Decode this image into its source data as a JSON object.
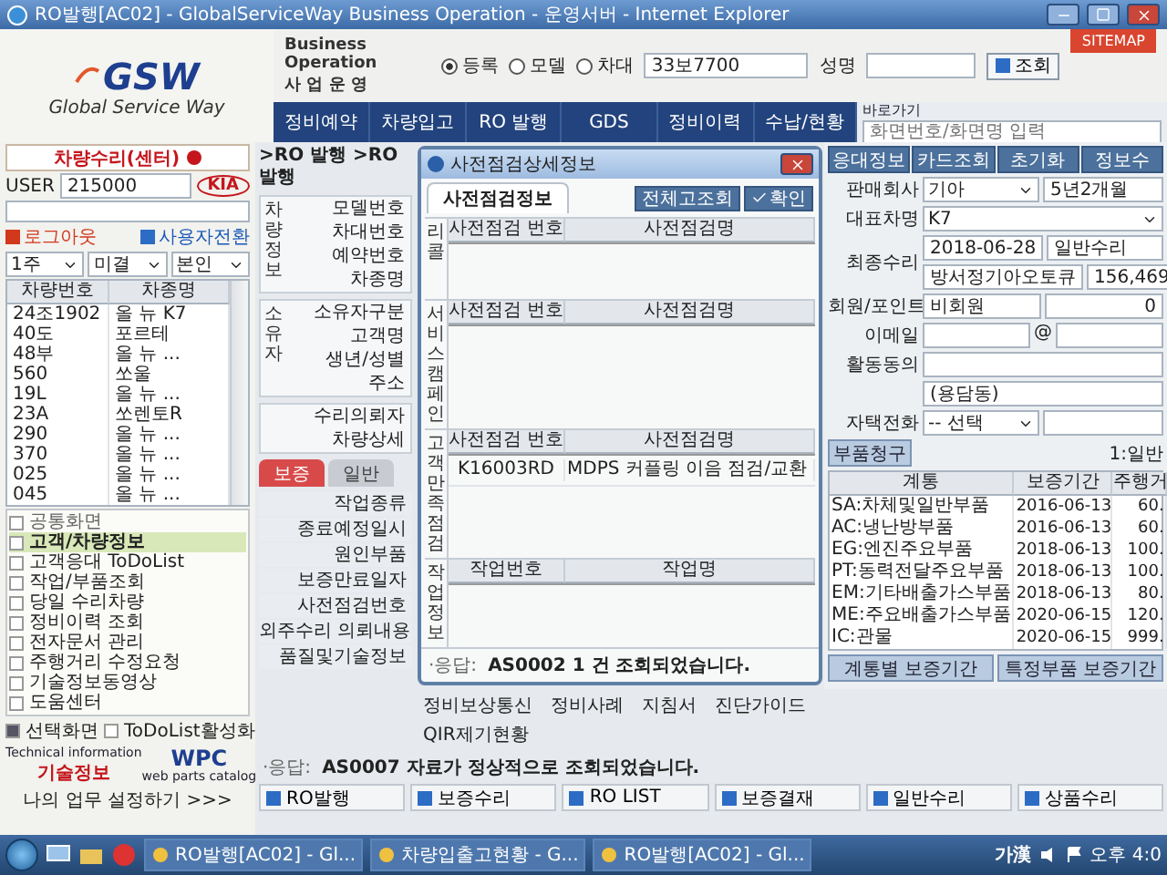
{
  "window": {
    "title": "RO발행[AC02] - GlobalServiceWay Business Operation - 운영서버 - Internet Explorer"
  },
  "header": {
    "logo": "GSW",
    "tagline": "Global Service Way",
    "app_title": "Business Operation",
    "app_subtitle": "사 업 운 영",
    "search_modes": [
      {
        "label": "등록",
        "selected": true
      },
      {
        "label": "모델",
        "selected": false
      },
      {
        "label": "차대",
        "selected": false
      }
    ],
    "search_value": "33보7700",
    "name_label": "성명",
    "search_button": "조회",
    "sitemap": "SITEMAP"
  },
  "nav": {
    "tabs": [
      "정비예약",
      "차량입고",
      "RO 발행",
      "GDS",
      "정비이력",
      "수납/현황"
    ],
    "shortcut_label": "바로가기",
    "shortcut_placeholder": "화면번호/화면명 입력"
  },
  "sidebar": {
    "mode_button": "차량수리(센터)",
    "user_label": "USER",
    "user_id": "215000",
    "brand": "KIA",
    "logout": "로그아웃",
    "switch_user": "사용자전환",
    "filters": [
      "1주",
      "미결",
      "본인"
    ],
    "vehicle_columns": [
      "차량번호",
      "차종명"
    ],
    "vehicles": [
      {
        "plate": "24조1902",
        "model": "올 뉴 K7"
      },
      {
        "plate": "40도",
        "model": "포르테"
      },
      {
        "plate": "48부",
        "model": "올 뉴 ..."
      },
      {
        "plate": "560",
        "model": "쏘울"
      },
      {
        "plate": "19L",
        "model": "올 뉴 ..."
      },
      {
        "plate": "23A",
        "model": "쏘렌토R"
      },
      {
        "plate": "290",
        "model": "올 뉴 ..."
      },
      {
        "plate": "370",
        "model": "올 뉴 ..."
      },
      {
        "plate": "025",
        "model": "올 뉴 ..."
      },
      {
        "plate": "045",
        "model": "올 뉴 ..."
      }
    ],
    "menu_title": "공통화면",
    "menu": [
      {
        "label": "고객/차량정보",
        "selected": true
      },
      {
        "label": "고객응대 ToDoList",
        "selected": false
      },
      {
        "label": "작업/부품조회",
        "selected": false
      },
      {
        "label": "당일 수리차량",
        "selected": false
      },
      {
        "label": "정비이력 조회",
        "selected": false
      },
      {
        "label": "전자문서 관리",
        "selected": false
      },
      {
        "label": "주행거리 수정요청",
        "selected": false
      },
      {
        "label": "기술정보동영상",
        "selected": false
      },
      {
        "label": "도움센터",
        "selected": false
      }
    ],
    "selection_label": "선택화면",
    "todo_toggle": {
      "label": "ToDoList활성화",
      "checked": false
    },
    "tech_info": {
      "caption": "Technical information",
      "label": "기술정보"
    },
    "wpc": {
      "logo": "WPC",
      "caption": "web parts catalog"
    },
    "my_settings": "나의 업무 설정하기 >>>"
  },
  "center": {
    "breadcrumb": ">RO 발행 >RO발행",
    "sections": [
      {
        "title": "차량정보",
        "fields": [
          "모델번호",
          "차대번호",
          "예약번호",
          "차종명"
        ]
      },
      {
        "title": "소유자",
        "fields": [
          "소유자구분",
          "고객명",
          "생년/성별",
          "주소"
        ]
      }
    ],
    "extra_fields": [
      "수리의뢰자",
      "차량상세"
    ],
    "tabs": [
      {
        "label": "보증",
        "selected": true
      },
      {
        "label": "일반",
        "selected": false
      }
    ],
    "work_fields": [
      "작업종류",
      "종료예정일시",
      "원인부품",
      "보증만료일자",
      "사전점검번호",
      "외주수리 의뢰내용",
      "품질및기술정보"
    ],
    "links": [
      "정비보상통신",
      "정비사례",
      "지침서",
      "진단가이드",
      "QIR제기현황"
    ],
    "status": {
      "prefix": "·응답:",
      "message": "AS0007 자료가 정상적으로 조회되었습니다."
    },
    "bottom_tabs": [
      "RO발행",
      "보증수리",
      "RO LIST",
      "보증결재",
      "일반수리",
      "상품수리"
    ]
  },
  "right": {
    "toolbar": [
      "응대정보",
      "카드조회",
      "초기화",
      "정보수"
    ],
    "sales_company": {
      "label": "판매회사",
      "value": "기아",
      "age": "5년2개월"
    },
    "model": {
      "label": "대표차명",
      "value": "K7"
    },
    "last_repair": {
      "label": "최종수리",
      "date": "2018-06-28",
      "type": "일반수리",
      "shop": "방서정기아오토큐",
      "mileage": "156,469"
    },
    "membership": {
      "label": "회원/포인트",
      "value": "비회원",
      "points": "0"
    },
    "email": {
      "label": "이메일",
      "at": "@"
    },
    "consent": {
      "label": "활동동의"
    },
    "district": "(용담동)",
    "phone": {
      "label": "자택전화",
      "value": "-- 선택"
    },
    "parts_button": "부품청구",
    "repair_class": "1:일반",
    "warranty_columns": [
      "계통",
      "보증기간",
      "주행거"
    ],
    "warranty_rows": [
      [
        "SA:차체및일반부품",
        "2016-06-13",
        "60."
      ],
      [
        "AC:냉난방부품",
        "2016-06-13",
        "60."
      ],
      [
        "EG:엔진주요부품",
        "2018-06-13",
        "100."
      ],
      [
        "PT:동력전달주요부품",
        "2018-06-13",
        "100."
      ],
      [
        "EM:기타배출가스부품",
        "2018-06-13",
        "80."
      ],
      [
        "ME:주요배출가스부품",
        "2020-06-15",
        "120."
      ],
      [
        "IC:관물",
        "2020-06-15",
        "999."
      ]
    ],
    "bottom_buttons": [
      "계통별 보증기간",
      "특정부품 보증기간"
    ]
  },
  "dialog": {
    "title": "사전점검상세정보",
    "tab": "사전점검정보",
    "buttons": [
      "전체고조회",
      "확인"
    ],
    "sections": [
      {
        "label": "리콜",
        "columns": [
          "사전점검 번호",
          "사전점검명"
        ]
      },
      {
        "label": "서비스캠페인",
        "columns": [
          "사전점검 번호",
          "사전점검명"
        ]
      },
      {
        "label": "고객만족점검",
        "columns": [
          "사전점검 번호",
          "사전점검명"
        ],
        "rows": [
          [
            "K16003RD",
            "MDPS 커플링 이음 점검/교환"
          ]
        ]
      },
      {
        "label": "작업정보",
        "columns": [
          "작업번호",
          "작업명"
        ]
      }
    ],
    "status": {
      "prefix": "·응답:",
      "message": "AS0002 1 건 조회되었습니다."
    }
  },
  "taskbar": {
    "tasks": [
      "RO발행[AC02] - Gl...",
      "차량입출고현황 - G...",
      "RO발행[AC02] - Gl..."
    ],
    "ime": "가漢",
    "clock": "오후 4:0"
  }
}
